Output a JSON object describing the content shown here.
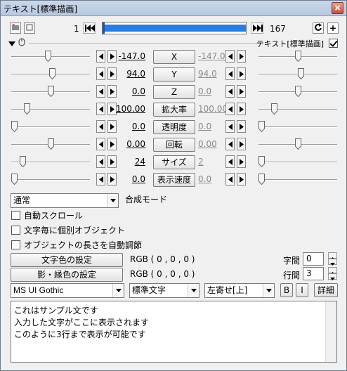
{
  "window": {
    "title": "テキスト[標準描画]"
  },
  "timeline": {
    "start_frame": "1",
    "end_frame": "167",
    "progress": 1.0
  },
  "header": {
    "object_label": "テキスト[標準描画]",
    "enabled": true
  },
  "rows": [
    {
      "name": "X",
      "value": "-147.0",
      "end_value": "-147.0",
      "left_pos": 0.47,
      "right_pos": 0.5
    },
    {
      "name": "Y",
      "value": "94.0",
      "end_value": "94.0",
      "left_pos": 0.52,
      "right_pos": 0.54
    },
    {
      "name": "Z",
      "value": "0.0",
      "end_value": "0.0",
      "left_pos": 0.5,
      "right_pos": 0.5
    },
    {
      "name": "拡大率",
      "value": "100.00",
      "end_value": "100.00",
      "left_pos": 0.17,
      "right_pos": 0.17
    },
    {
      "name": "透明度",
      "value": "0.0",
      "end_value": "0.0",
      "left_pos": 0.0,
      "right_pos": 0.0
    },
    {
      "name": "回転",
      "value": "0.00",
      "end_value": "0.00",
      "left_pos": 0.5,
      "right_pos": 0.5
    },
    {
      "name": "サイズ",
      "value": "24",
      "end_value": "2",
      "left_pos": 0.12,
      "right_pos": 0.0
    },
    {
      "name": "表示速度",
      "value": "0.0",
      "end_value": "0.0",
      "left_pos": 0.0,
      "right_pos": 0.0
    }
  ],
  "blend": {
    "selected": "通常",
    "label": "合成モード"
  },
  "options": {
    "auto_scroll": "自動スクロール",
    "per_char": "文字毎に個別オブジェクト",
    "auto_length": "オブジェクトの長さを自動調節"
  },
  "colors": {
    "text_color_button": "文字色の設定",
    "text_color_value": "RGB ( 0 , 0 , 0 )",
    "shadow_color_button": "影・縁色の設定",
    "shadow_color_value": "RGB ( 0 , 0 , 0 )"
  },
  "spacing": {
    "char_label": "字間",
    "char_value": "0",
    "line_label": "行間",
    "line_value": "3"
  },
  "font": {
    "family": "MS UI Gothic",
    "style": "標準文字",
    "align": "左寄せ[上]",
    "bold_label": "B",
    "italic_label": "I",
    "detail_label": "詳細"
  },
  "text": {
    "lines": [
      "これはサンプル文です",
      "入力した文字がここに表示されます",
      "このように3行まで表示が可能です"
    ]
  },
  "accent": {
    "bar": "#2a7de0",
    "close": "#c5503a"
  }
}
